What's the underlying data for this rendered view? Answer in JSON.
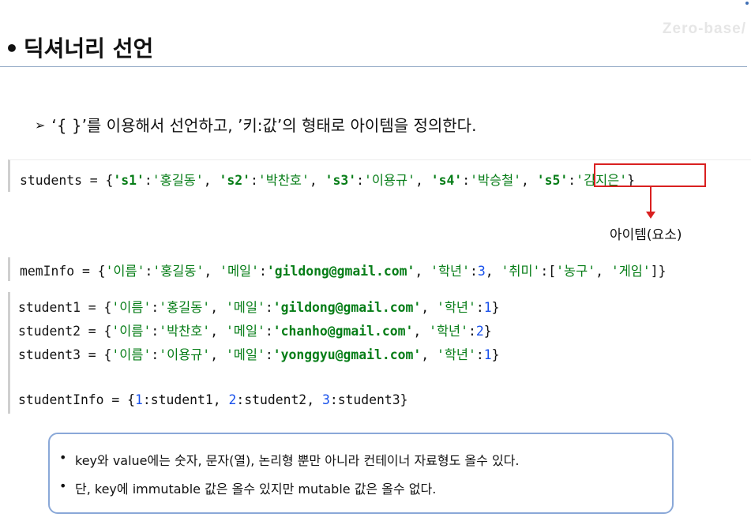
{
  "watermark": "Zero-base/",
  "title": {
    "bullet": "•",
    "text": "딕셔너리 선언"
  },
  "subtitle": {
    "arrow": "➢",
    "text": "‘{ }’를 이용해서 선언하고, ’키:값’의 형태로 아이템을 정의한다."
  },
  "code_line_1": {
    "a": "students = {",
    "k1": "'s1'",
    "v1": "'홍길동'",
    "k2": "'s2'",
    "v2": "'박찬호'",
    "k3": "'s3'",
    "v3": "'이용규'",
    "k4": "'s4'",
    "v4": "'박승철'",
    "k5": "'s5'",
    "v5": "'김지은'",
    "end": "}"
  },
  "annotation_label": "아이템(요소)",
  "code_line_2": {
    "a": "memInfo = {",
    "k1": "'이름'",
    "v1": "'홍길동'",
    "k2": "'메일'",
    "v2": "'gildong@gmail.com'",
    "k3": "'학년'",
    "v3": "3",
    "k4": "'취미'",
    "v4a": "'농구'",
    "v4b": "'게임'",
    "end": "]}"
  },
  "code_line_3": {
    "a": "student1 = {",
    "k1": "'이름'",
    "v1": "'홍길동'",
    "k2": "'메일'",
    "v2": "'gildong@gmail.com'",
    "k3": "'학년'",
    "v3": "1",
    "end": "}"
  },
  "code_line_4": {
    "a": "student2 = {",
    "k1": "'이름'",
    "v1": "'박찬호'",
    "k2": "'메일'",
    "v2": "'chanho@gmail.com'",
    "k3": "'학년'",
    "v3": "2",
    "end": "}"
  },
  "code_line_5": {
    "a": "student3 = {",
    "k1": "'이름'",
    "v1": "'이용규'",
    "k2": "'메일'",
    "v2": "'yonggyu@gmail.com'",
    "k3": "'학년'",
    "v3": "1",
    "end": "}"
  },
  "code_line_6": {
    "a": "studentInfo = {",
    "n1": "1",
    "v1": "student1",
    "n2": "2",
    "v2": "student2",
    "n3": "3",
    "v3": "student3",
    "end": "}"
  },
  "notes": [
    "key와 value에는 숫자, 문자(열), 논리형 뿐만 아니라 컨테이너 자료형도 올수 있다.",
    "단, key에 immutable 값은 올수 있지만 mutable 값은 올수 없다."
  ],
  "colors": {
    "string": "#067d17",
    "number": "#1750eb",
    "highlight": "#d92020",
    "note_border": "#8aa8d8"
  }
}
